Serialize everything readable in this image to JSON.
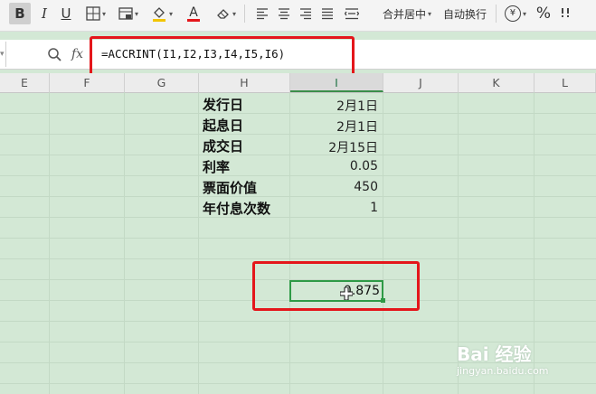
{
  "toolbar": {
    "bold": "B",
    "italic": "I",
    "underline": "U",
    "font_color_letter": "A",
    "merge_center": "合并居中",
    "wrap_text": "自动换行",
    "percent": "%",
    "currency": "¥"
  },
  "formula_bar": {
    "fx": "fx",
    "formula": "=ACCRINT(I1,I2,I3,I4,I5,I6)"
  },
  "columns": [
    "E",
    "F",
    "G",
    "H",
    "I",
    "J",
    "K",
    "L"
  ],
  "rows": [
    {
      "label": "发行日",
      "value": "2月1日"
    },
    {
      "label": "起息日",
      "value": "2月1日"
    },
    {
      "label": "成交日",
      "value": "2月15日"
    },
    {
      "label": "利率",
      "value": "0.05"
    },
    {
      "label": "票面价值",
      "value": "450"
    },
    {
      "label": "年付息次数",
      "value": "1"
    }
  ],
  "result": "0.875",
  "watermark": {
    "logo": "Bai 经验",
    "site": "jingyan.baidu.com"
  },
  "colors": {
    "sheet_bg": "#d3e8d5",
    "highlight_red": "#e4161b",
    "active_green": "#2e9a46"
  }
}
